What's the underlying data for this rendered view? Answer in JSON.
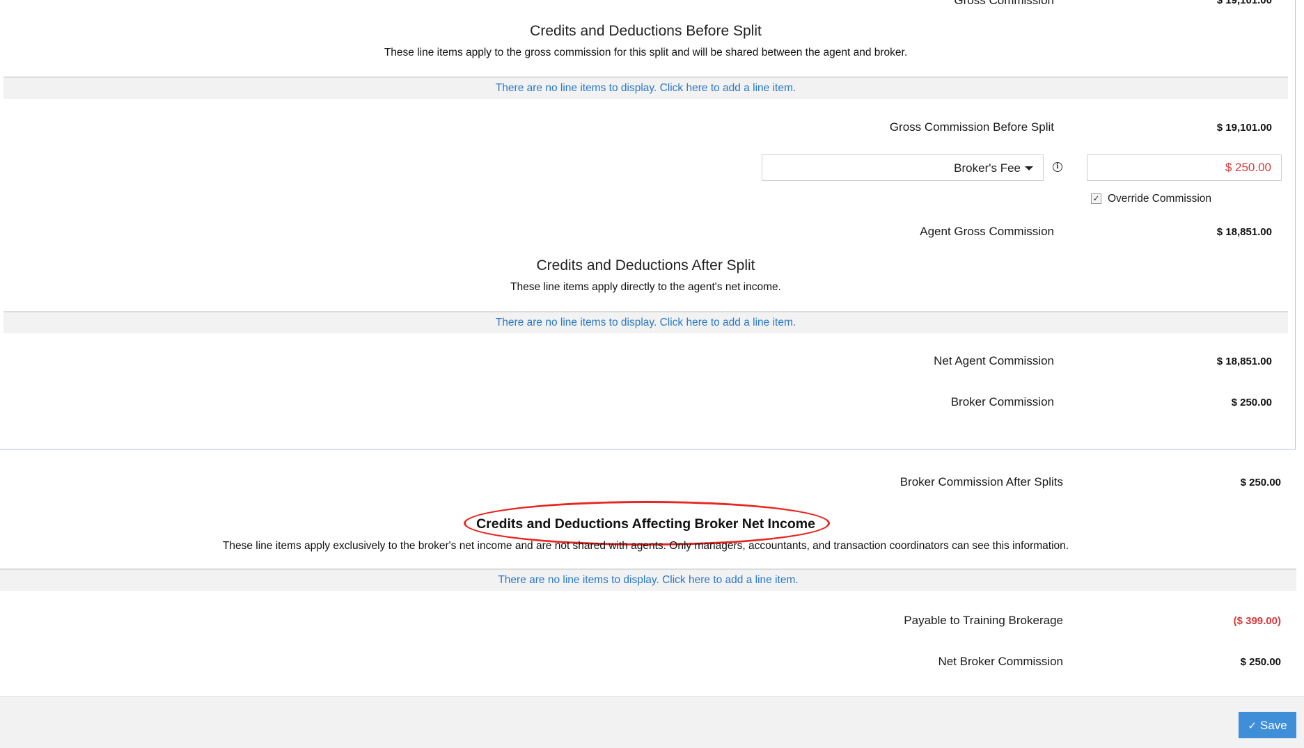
{
  "top_partial": {
    "label": "Gross Commission",
    "value": "$ 19,101.00"
  },
  "before_split": {
    "title": "Credits and Deductions Before Split",
    "description": "These line items apply to the gross commission for this split and will be shared between the agent and broker.",
    "empty_text": "There are no line items to display. Click here to add a line item."
  },
  "gross_before_split": {
    "label": "Gross Commission Before Split",
    "value": "$ 19,101.00"
  },
  "broker_fee": {
    "selected": "Broker's Fee",
    "amount": "$ 250.00",
    "info_icon": "info-circle-icon"
  },
  "override": {
    "label": "Override Commission",
    "checked": true,
    "check_glyph": "✓"
  },
  "agent_gross": {
    "label": "Agent Gross Commission",
    "value": "$ 18,851.00"
  },
  "after_split": {
    "title": "Credits and Deductions After Split",
    "description": "These line items apply directly to the agent's net income.",
    "empty_text": "There are no line items to display. Click here to add a line item."
  },
  "net_agent": {
    "label": "Net Agent Commission",
    "value": "$ 18,851.00"
  },
  "broker_commission": {
    "label": "Broker Commission",
    "value": "$ 250.00"
  },
  "broker_after_splits": {
    "label": "Broker Commission After Splits",
    "value": "$ 250.00"
  },
  "broker_net_section": {
    "title": "Credits and Deductions Affecting Broker Net Income",
    "description": "These line items apply exclusively to the broker's net income and are not shared with agents. Only managers, accountants, and transaction coordinators can see this information.",
    "empty_text": "There are no line items to display. Click here to add a line item."
  },
  "payable_training": {
    "label": "Payable to Training Brokerage",
    "value": "($ 399.00)"
  },
  "net_broker": {
    "label": "Net Broker Commission",
    "value": "$ 250.00"
  },
  "footer": {
    "save_label": "Save",
    "save_icon": "check-icon"
  },
  "colors": {
    "link": "#2a78c6",
    "negative": "#d9383a",
    "save_button": "#3e8ed8",
    "annotation": "#e8261f"
  }
}
